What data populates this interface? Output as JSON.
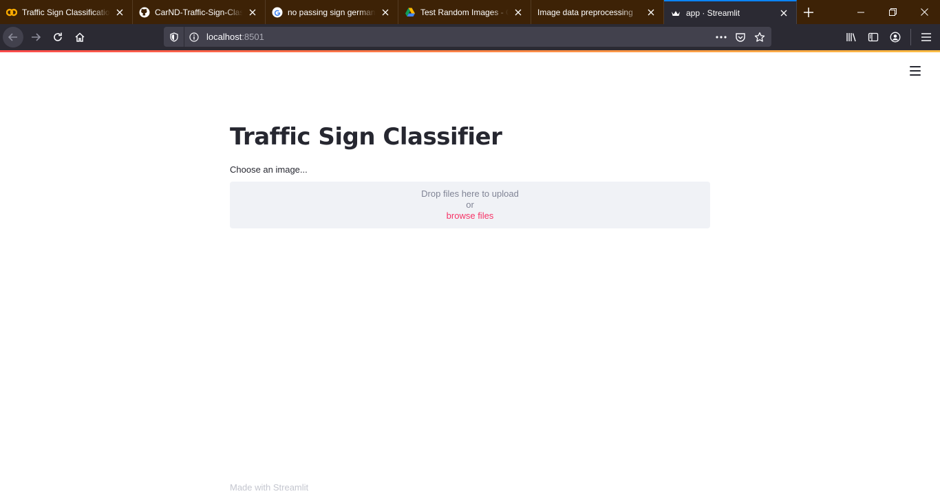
{
  "browser": {
    "tabs": [
      {
        "title": "Traffic Sign Classification",
        "icon": "colab-icon",
        "active": false
      },
      {
        "title": "CarND-Traffic-Sign-Classifier",
        "icon": "github-icon",
        "active": false
      },
      {
        "title": "no passing sign german",
        "icon": "google-icon",
        "active": false
      },
      {
        "title": "Test Random Images - Google Drive",
        "icon": "google-drive-icon",
        "active": false
      },
      {
        "title": "Image data preprocessing",
        "icon": "",
        "active": false
      },
      {
        "title": "app · Streamlit",
        "icon": "streamlit-icon",
        "active": true
      }
    ],
    "url": {
      "host": "localhost",
      "port": ":8501"
    }
  },
  "page": {
    "title": "Traffic Sign Classifier",
    "uploader": {
      "label": "Choose an image...",
      "drop_text": "Drop files here to upload",
      "or_text": "or",
      "browse_text": "browse files"
    },
    "footer": "Made with Streamlit"
  },
  "colors": {
    "tabstrip": "#3d2206",
    "toolbar": "#2b2a33",
    "accent": "#f63366",
    "text": "#262730"
  }
}
